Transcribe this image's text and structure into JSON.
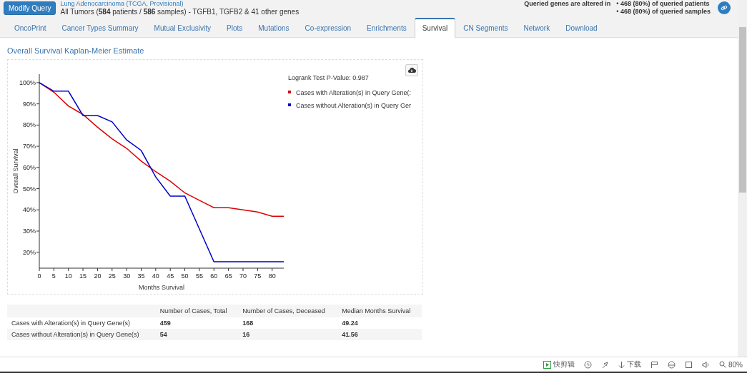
{
  "header": {
    "modify_button": "Modify Query",
    "study": "Lung Adenocarcinoma (TCGA, Provisional)",
    "summary": "All Tumors (**584** patients / **586** samples)  - TGFB1, TGFB2 & 41 other genes",
    "altered_label": "Queried genes are altered in",
    "altered_patients": "• 468 (80%) of queried patients",
    "altered_samples": "• 468 (80%) of queried samples"
  },
  "tabs": [
    {
      "label": "OncoPrint",
      "selected": false
    },
    {
      "label": "Cancer Types Summary",
      "selected": false
    },
    {
      "label": "Mutual Exclusivity",
      "selected": false
    },
    {
      "label": "Plots",
      "selected": false
    },
    {
      "label": "Mutations",
      "selected": false
    },
    {
      "label": "Co-expression",
      "selected": false
    },
    {
      "label": "Enrichments",
      "selected": false
    },
    {
      "label": "Survival",
      "selected": true
    },
    {
      "label": "CN Segments",
      "selected": false
    },
    {
      "label": "Network",
      "selected": false
    },
    {
      "label": "Download",
      "selected": false
    }
  ],
  "section_title": "Overall Survival Kaplan-Meier Estimate",
  "chart": {
    "pvalue": "Logrank Test P-Value: 0.987",
    "chart_data": {
      "type": "line",
      "xlabel": "Months Survival",
      "ylabel": "Overall Survival",
      "x": [
        0,
        5,
        10,
        15,
        20,
        25,
        30,
        35,
        40,
        45,
        50,
        55,
        60,
        65,
        70,
        75,
        80,
        84
      ],
      "series": [
        {
          "name": "Cases with Alteration(s) in Query Gene(:",
          "color": "#dc0000",
          "values": [
            1.0,
            0.955,
            0.89,
            0.85,
            0.79,
            0.735,
            0.69,
            0.63,
            0.58,
            0.535,
            0.48,
            0.445,
            0.41,
            0.41,
            0.4,
            0.39,
            0.37,
            0.37
          ]
        },
        {
          "name": "Cases without Alteration(s) in Query Ger",
          "color": "#0000c8",
          "values": [
            1.0,
            0.96,
            0.96,
            0.845,
            0.845,
            0.815,
            0.73,
            0.68,
            0.555,
            0.465,
            0.465,
            0.31,
            0.155,
            0.155,
            0.155,
            0.155,
            0.155,
            0.155
          ]
        }
      ],
      "legend": true,
      "xlim": [
        0,
        84
      ],
      "ylim": [
        0.125,
        1.04
      ],
      "xticks": [
        0,
        5,
        10,
        15,
        20,
        25,
        30,
        35,
        40,
        45,
        50,
        55,
        60,
        65,
        70,
        75,
        80
      ],
      "yticks": [
        {
          "value": 0.2,
          "label": "20%"
        },
        {
          "value": 0.3,
          "label": "30%"
        },
        {
          "value": 0.4,
          "label": "40%"
        },
        {
          "value": 0.5,
          "label": "50%"
        },
        {
          "value": 0.6,
          "label": "60%"
        },
        {
          "value": 0.7,
          "label": "70%"
        },
        {
          "value": 0.8,
          "label": "80%"
        },
        {
          "value": 0.9,
          "label": "90%"
        },
        {
          "value": 1.0,
          "label": "100%"
        }
      ]
    }
  },
  "table": {
    "columns": [
      "Number of Cases, Total",
      "Number of Cases, Deceased",
      "Median Months Survival"
    ],
    "rows": [
      {
        "label": "Cases with Alteration(s) in Query Gene(s)",
        "cells": [
          "459",
          "168",
          "49.24"
        ]
      },
      {
        "label": "Cases without Alteration(s) in Query Gene(s)",
        "cells": [
          "54",
          "16",
          "41.56"
        ]
      }
    ]
  },
  "status_bar": {
    "clip": "快剪辑",
    "download": "下载",
    "zoom": "80%"
  }
}
